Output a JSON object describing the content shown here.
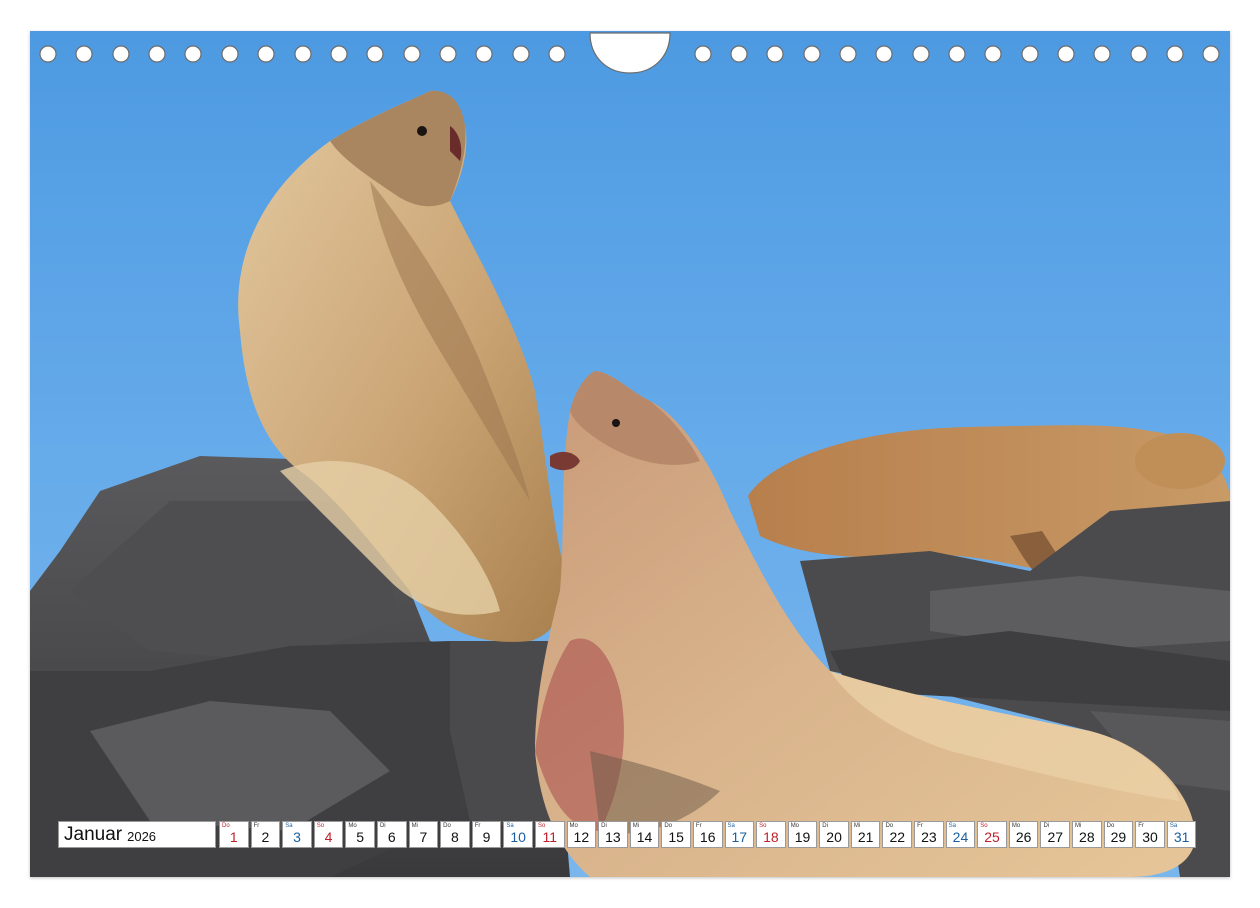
{
  "calendar": {
    "month": "Januar",
    "year": "2026",
    "days": [
      {
        "wd": "Do",
        "num": "1",
        "kind": "holiday"
      },
      {
        "wd": "Fr",
        "num": "2",
        "kind": "weekday"
      },
      {
        "wd": "Sa",
        "num": "3",
        "kind": "sat"
      },
      {
        "wd": "So",
        "num": "4",
        "kind": "sun"
      },
      {
        "wd": "Mo",
        "num": "5",
        "kind": "weekday"
      },
      {
        "wd": "Di",
        "num": "6",
        "kind": "weekday"
      },
      {
        "wd": "Mi",
        "num": "7",
        "kind": "weekday"
      },
      {
        "wd": "Do",
        "num": "8",
        "kind": "weekday"
      },
      {
        "wd": "Fr",
        "num": "9",
        "kind": "weekday"
      },
      {
        "wd": "Sa",
        "num": "10",
        "kind": "sat"
      },
      {
        "wd": "So",
        "num": "11",
        "kind": "sun"
      },
      {
        "wd": "Mo",
        "num": "12",
        "kind": "weekday"
      },
      {
        "wd": "Di",
        "num": "13",
        "kind": "weekday"
      },
      {
        "wd": "Mi",
        "num": "14",
        "kind": "weekday"
      },
      {
        "wd": "Do",
        "num": "15",
        "kind": "weekday"
      },
      {
        "wd": "Fr",
        "num": "16",
        "kind": "weekday"
      },
      {
        "wd": "Sa",
        "num": "17",
        "kind": "sat"
      },
      {
        "wd": "So",
        "num": "18",
        "kind": "sun"
      },
      {
        "wd": "Mo",
        "num": "19",
        "kind": "weekday"
      },
      {
        "wd": "Di",
        "num": "20",
        "kind": "weekday"
      },
      {
        "wd": "Mi",
        "num": "21",
        "kind": "weekday"
      },
      {
        "wd": "Do",
        "num": "22",
        "kind": "weekday"
      },
      {
        "wd": "Fr",
        "num": "23",
        "kind": "weekday"
      },
      {
        "wd": "Sa",
        "num": "24",
        "kind": "sat"
      },
      {
        "wd": "So",
        "num": "25",
        "kind": "sun"
      },
      {
        "wd": "Mo",
        "num": "26",
        "kind": "weekday"
      },
      {
        "wd": "Di",
        "num": "27",
        "kind": "weekday"
      },
      {
        "wd": "Mi",
        "num": "28",
        "kind": "weekday"
      },
      {
        "wd": "Do",
        "num": "29",
        "kind": "weekday"
      },
      {
        "wd": "Fr",
        "num": "30",
        "kind": "weekday"
      },
      {
        "wd": "Sa",
        "num": "31",
        "kind": "sat"
      }
    ]
  },
  "colors": {
    "sky": "#5fa6e6",
    "saturday": "#1a5f9e",
    "sunday": "#c0202a",
    "rock": "#4a4a4c",
    "sea_lion": "#d9b88a"
  }
}
